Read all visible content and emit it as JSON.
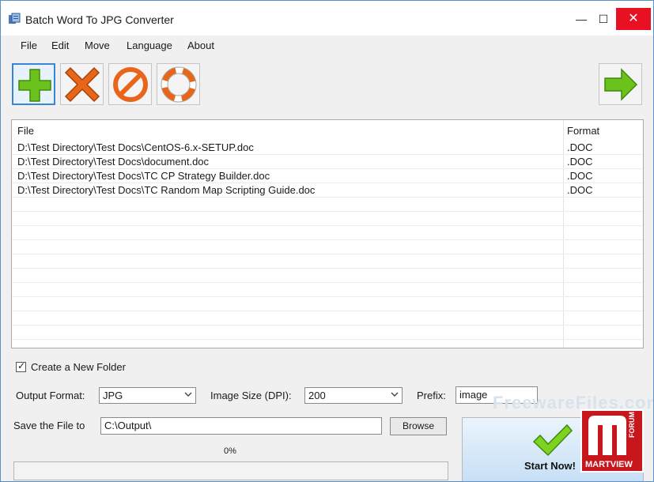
{
  "window": {
    "title": "Batch Word To JPG Converter"
  },
  "window_controls": {
    "minimize": "—",
    "maximize": "☐",
    "close": "✕"
  },
  "menu": {
    "file": "File",
    "edit": "Edit",
    "move": "Move",
    "language": "Language",
    "about": "About"
  },
  "toolbar": {
    "add": "add-icon",
    "remove": "remove-icon",
    "clear": "clear-icon",
    "help": "help-icon",
    "next": "next-arrow-icon"
  },
  "filelist": {
    "headers": {
      "file": "File",
      "format": "Format"
    },
    "rows": [
      {
        "file": "D:\\Test Directory\\Test Docs\\CentOS-6.x-SETUP.doc",
        "format": ".DOC"
      },
      {
        "file": "D:\\Test Directory\\Test Docs\\document.doc",
        "format": ".DOC"
      },
      {
        "file": "D:\\Test Directory\\Test Docs\\TC CP Strategy Builder.doc",
        "format": ".DOC"
      },
      {
        "file": "D:\\Test Directory\\Test Docs\\TC Random Map Scripting Guide.doc",
        "format": ".DOC"
      }
    ]
  },
  "options": {
    "create_folder_label": "Create a New Folder",
    "create_folder_checked": true,
    "check_mark": "✓",
    "output_format_label": "Output Format:",
    "output_format_value": "JPG",
    "image_size_label": "Image Size (DPI):",
    "image_size_value": "200",
    "prefix_label": "Prefix:",
    "prefix_value": "image",
    "save_label": "Save the File to",
    "save_path": "C:\\Output\\",
    "browse_label": "Browse"
  },
  "progress": {
    "text": "0%",
    "value": 0
  },
  "start": {
    "label": "Start Now!"
  },
  "watermark": {
    "text": "FreewareFiles.com"
  },
  "badge": {
    "text": "MARTVIEW",
    "side": "FORUM"
  },
  "colors": {
    "close_red": "#e81123",
    "accent_blue": "#3b86d4",
    "add_green": "#6bc21c",
    "remove_orange": "#e8651a",
    "badge_red": "#c8161d"
  }
}
